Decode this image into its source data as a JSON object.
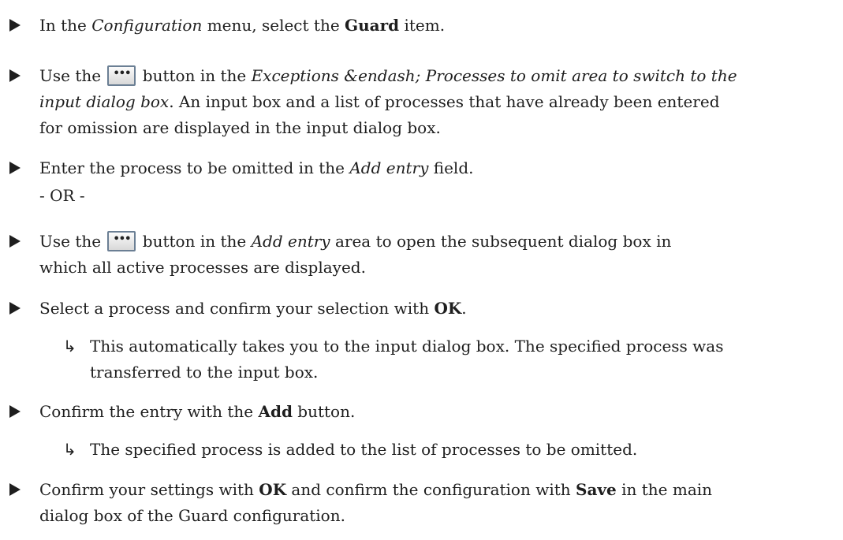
{
  "steps": [
    {
      "a": "In the ",
      "menu": "Configuration",
      "b": " menu, select the ",
      "item": "Guard",
      "c": " item."
    },
    {
      "a": "Use the ",
      "b": " button in the ",
      "area": "Exceptions &endash; Processes to omit area to switch to the",
      "line2_italic": "input dialog box",
      "line2_rest": ". An input box and a list of processes that have already been entered",
      "line3": "for omission are displayed in the input dialog box."
    },
    {
      "a": "Enter the process to be omitted in the ",
      "field": "Add entry",
      "b": " field.",
      "or": "- OR -"
    },
    {
      "a": "Use the ",
      "b": " button in the ",
      "area": "Add entry",
      "c": " area to open the subsequent dialog box in",
      "line2": "which all active processes are displayed."
    },
    {
      "a": "Select a process and confirm your selection with ",
      "ok": "OK",
      "b": "."
    },
    {
      "result_line1": "This automatically takes you to the input dialog box. The specified process was",
      "result_line2": "transferred to the input box."
    },
    {
      "a": "Confirm the entry with the ",
      "add": "Add",
      "b": " button."
    },
    {
      "result": "The specified process is added to the list of processes to be omitted."
    },
    {
      "a": "Confirm your settings with ",
      "ok": "OK",
      "b": " and confirm the configuration with ",
      "save": "Save",
      "c": " in the main",
      "line2": "dialog box of the Guard configuration."
    }
  ],
  "icons": {
    "bullet": "triangle-right-icon",
    "result": "result-arrow-icon",
    "button": "ellipsis-button-icon"
  }
}
